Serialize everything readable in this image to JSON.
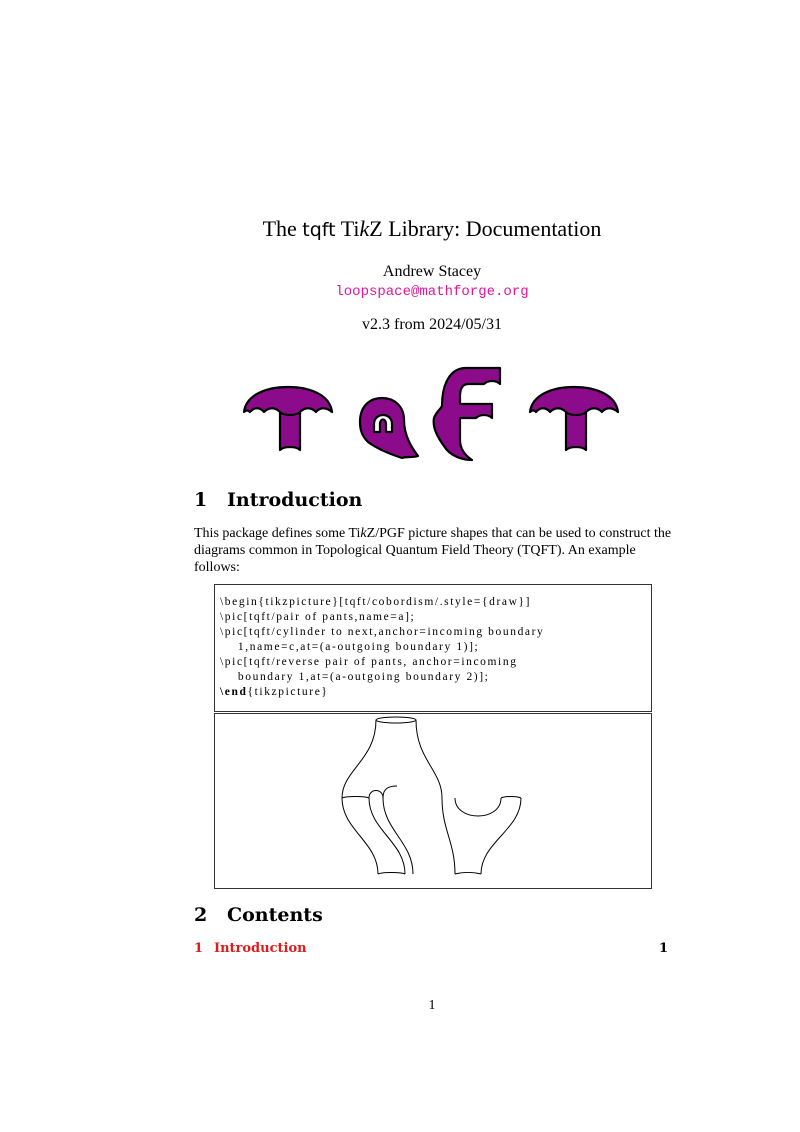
{
  "title": {
    "prefix": "The",
    "sf": "tqft",
    "tikz_a": "Ti",
    "tikz_k": "k",
    "tikz_b": "Z",
    "rest": "Library: Documentation"
  },
  "author": "Andrew Stacey",
  "email": "loopspace@mathforge.org",
  "version": "v2.3 from 2024/05/31",
  "logo": {
    "letters": "TQFT",
    "fill": "#8b0b8b",
    "stroke": "#000000"
  },
  "sections": [
    {
      "number": "1",
      "title": "Introduction"
    },
    {
      "number": "2",
      "title": "Contents"
    }
  ],
  "intro": {
    "text_a": "This package defines some Ti",
    "text_k": "k",
    "text_b": "Z/PGF picture shapes that can be used to construct the diagrams common in Topological Quantum Field Theory (TQFT). An example follows:"
  },
  "code": {
    "lines": [
      "\\begin{tikzpicture}[tqft/cobordism/.style={draw}]",
      "\\pic[tqft/pair of pants,name=a];",
      "\\pic[tqft/cylinder to next,anchor=incoming boundary",
      "    1,name=c,at=(a-outgoing boundary 1)];",
      "\\pic[tqft/reverse pair of pants, anchor=incoming",
      "    boundary 1,at=(a-outgoing boundary 2)];",
      "\\end{tikzpicture}"
    ]
  },
  "toc": [
    {
      "number": "1",
      "label": "Introduction",
      "page": "1"
    }
  ],
  "page_number": "1"
}
